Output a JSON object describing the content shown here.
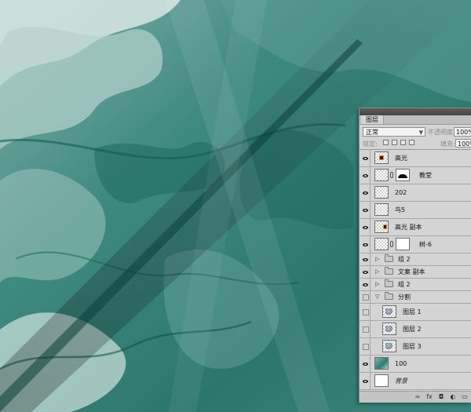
{
  "canvas": {
    "description_colors": {
      "base": "#2f7a72",
      "light": "#c9dcd8",
      "dark": "#0f4a44"
    }
  },
  "panel": {
    "tab_label": "图层",
    "blend_mode": "正常",
    "opacity_label": "不透明度:",
    "opacity_value": "100%",
    "lock_label": "锁定:",
    "fill_label": "填充:",
    "fill_value": "100%",
    "layers": [
      {
        "name": "高光",
        "visible": true,
        "kind": "layer",
        "thumb": "dark-dot"
      },
      {
        "name": "教堂",
        "visible": true,
        "kind": "layer-mask",
        "thumb": "checker",
        "mask": "silhouette"
      },
      {
        "name": "202",
        "visible": true,
        "kind": "layer",
        "thumb": "checker"
      },
      {
        "name": "鸟5",
        "visible": true,
        "kind": "layer",
        "thumb": "checker"
      },
      {
        "name": "高光 副本",
        "visible": true,
        "kind": "layer",
        "thumb": "checker-dot"
      },
      {
        "name": "树-6",
        "visible": true,
        "kind": "layer-mask",
        "thumb": "checker",
        "mask": "white"
      },
      {
        "name": "组 2",
        "visible": true,
        "kind": "group",
        "expanded": false
      },
      {
        "name": "文案 副本",
        "visible": true,
        "kind": "group",
        "expanded": false
      },
      {
        "name": "组 2",
        "visible": true,
        "kind": "group",
        "expanded": false
      },
      {
        "name": "分割",
        "visible": false,
        "kind": "group",
        "expanded": true
      },
      {
        "name": "图层 1",
        "visible": false,
        "kind": "child",
        "thumb": "checker-mark"
      },
      {
        "name": "图层 2",
        "visible": false,
        "kind": "child",
        "thumb": "checker-mark"
      },
      {
        "name": "图层 3",
        "visible": false,
        "kind": "child",
        "thumb": "checker-mark"
      },
      {
        "name": "100",
        "visible": true,
        "kind": "layer",
        "thumb": "teal"
      },
      {
        "name": "背景",
        "visible": true,
        "kind": "background",
        "thumb": "white"
      }
    ],
    "footer_icons": [
      "link-icon",
      "fx-icon",
      "mask-icon",
      "adjustment-icon",
      "folder-icon"
    ]
  }
}
